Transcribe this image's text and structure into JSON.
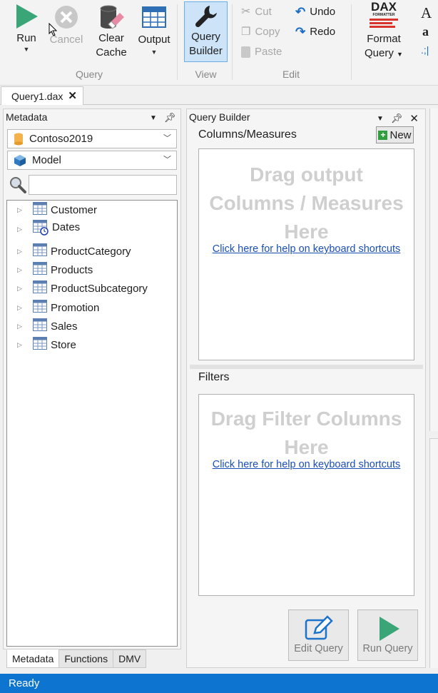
{
  "ribbon": {
    "run_label": "Run",
    "cancel_label": "Cancel",
    "clear_cache_label_1": "Clear",
    "clear_cache_label_2": "Cache",
    "output_label": "Output",
    "query_builder_label_1": "Query",
    "query_builder_label_2": "Builder",
    "cut_label": "Cut",
    "copy_label": "Copy",
    "paste_label": "Paste",
    "undo_label": "Undo",
    "redo_label": "Redo",
    "dax_logo_text": "DAX",
    "dax_logo_sub": "FORMATTER",
    "format_query_label_1": "Format",
    "format_query_label_2": "Query",
    "group_query": "Query",
    "group_view": "View",
    "group_edit": "Edit",
    "font_large_glyph": "A",
    "font_small_glyph": "a",
    "more_glyph": ".;|"
  },
  "document_tab": {
    "title": "Query1.dax"
  },
  "metadata": {
    "title": "Metadata",
    "database": "Contoso2019",
    "model": "Model",
    "search_placeholder": "",
    "tables": [
      {
        "name": "Customer"
      },
      {
        "name": "Dates"
      },
      {
        "name": "ProductCategory"
      },
      {
        "name": "Products"
      },
      {
        "name": "ProductSubcategory"
      },
      {
        "name": "Promotion"
      },
      {
        "name": "Sales"
      },
      {
        "name": "Store"
      }
    ],
    "bottom_tabs": [
      "Metadata",
      "Functions",
      "DMV"
    ]
  },
  "query_builder": {
    "title": "Query Builder",
    "columns_header": "Columns/Measures",
    "new_label": "New",
    "columns_placeholder_1": "Drag output",
    "columns_placeholder_2": "Columns / Measures",
    "columns_placeholder_3": "Here",
    "help_link": "Click here for help on keyboard shortcuts",
    "filters_header": "Filters",
    "filters_placeholder_1": "Drag Filter Columns",
    "filters_placeholder_2": "Here",
    "edit_query_label": "Edit Query",
    "run_query_label": "Run Query"
  },
  "status": {
    "text": "Ready"
  },
  "colors": {
    "accent": "#0d74d0",
    "run_green": "#3aa576",
    "link_blue": "#1a4fb8",
    "placeholder_gray": "#cfcfcf"
  }
}
